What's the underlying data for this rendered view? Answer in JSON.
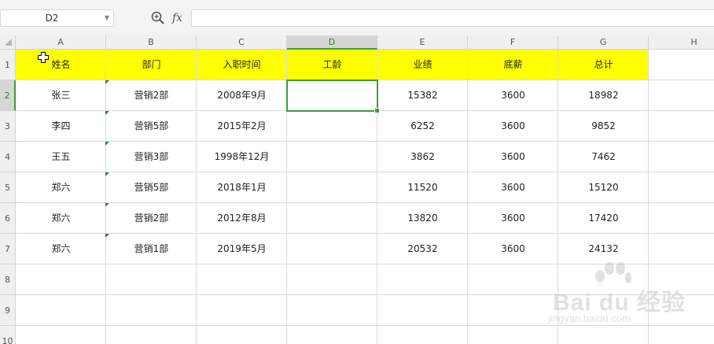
{
  "name_box": {
    "value": "D2"
  },
  "formula": {
    "fx_label": "fx",
    "value": ""
  },
  "columns": [
    "A",
    "B",
    "C",
    "D",
    "E",
    "F",
    "G",
    "H"
  ],
  "rows": [
    "1",
    "2",
    "3",
    "4",
    "5",
    "6",
    "7",
    "8",
    "9",
    "10"
  ],
  "selected_cell": "D2",
  "header_fill_color": "#ffff00",
  "headers": [
    "姓名",
    "部门",
    "入职时间",
    "工龄",
    "业绩",
    "底薪",
    "总计"
  ],
  "data_rows": [
    [
      "张三",
      "营销2部",
      "2008年9月",
      "",
      "15382",
      "3600",
      "18982"
    ],
    [
      "李四",
      "营销5部",
      "2015年2月",
      "",
      "6252",
      "3600",
      "9852"
    ],
    [
      "王五",
      "营销3部",
      "1998年12月",
      "",
      "3862",
      "3600",
      "7462"
    ],
    [
      "郑六",
      "营销5部",
      "2018年1月",
      "",
      "11520",
      "3600",
      "15120"
    ],
    [
      "郑六",
      "营销2部",
      "2012年8月",
      "",
      "13820",
      "3600",
      "17420"
    ],
    [
      "郑六",
      "营销1部",
      "2019年5月",
      "",
      "20532",
      "3600",
      "24132"
    ]
  ],
  "watermark": {
    "brand": "Bai du 经验",
    "url": "jingyan.baidu.com"
  }
}
